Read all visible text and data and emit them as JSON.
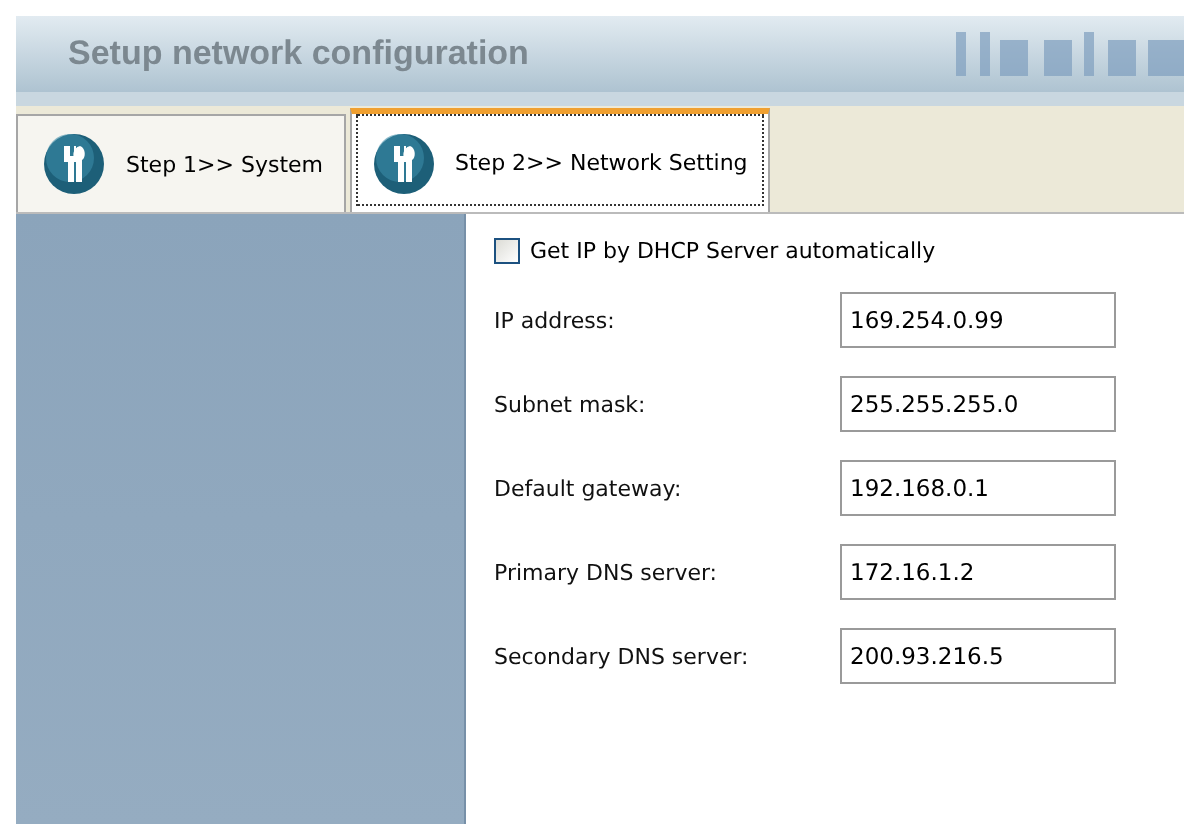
{
  "header": {
    "title": "Setup network configuration"
  },
  "tabs": [
    {
      "label": "Step 1>> System",
      "selected": false
    },
    {
      "label": "Step 2>> Network Setting",
      "selected": true
    }
  ],
  "dhcp": {
    "label": "Get IP by DHCP Server automatically",
    "checked": false
  },
  "fields": [
    {
      "label": "IP address:",
      "value": "169.254.0.99"
    },
    {
      "label": "Subnet mask:",
      "value": "255.255.255.0"
    },
    {
      "label": "Default gateway:",
      "value": "192.168.0.1"
    },
    {
      "label": "Primary DNS server:",
      "value": "172.16.1.2"
    },
    {
      "label": "Secondary DNS server:",
      "value": "200.93.216.5"
    }
  ]
}
